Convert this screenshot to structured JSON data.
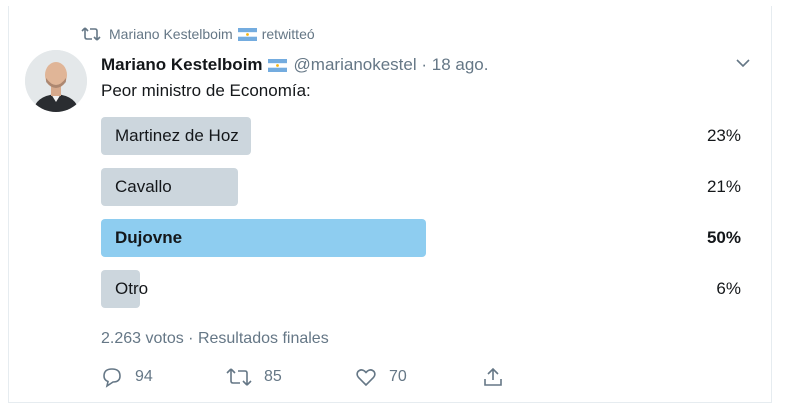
{
  "retweet": {
    "user": "Mariano Kestelboim",
    "action": "retwitteó",
    "icon": "retweet-icon"
  },
  "tweet": {
    "author_name": "Mariano Kestelboim",
    "handle_and_time": "@marianokestel · 18 ago.",
    "text": "Peor ministro de Economía:",
    "avatar_icon": "avatar"
  },
  "poll": {
    "options": [
      {
        "label": "Martinez de Hoz",
        "percent": "23%",
        "fraction": 0.23,
        "winner": false
      },
      {
        "label": "Cavallo",
        "percent": "21%",
        "fraction": 0.21,
        "winner": false
      },
      {
        "label": "Dujovne",
        "percent": "50%",
        "fraction": 0.5,
        "winner": true
      },
      {
        "label": "Otro",
        "percent": "6%",
        "fraction": 0.06,
        "winner": false
      }
    ],
    "summary": "2.263 votos · Resultados finales"
  },
  "actions": {
    "replies": "94",
    "retweets": "85",
    "likes": "70"
  },
  "colors": {
    "bar": "#ccd6dd",
    "winner_bar": "#8ecdf0",
    "secondary_text": "#657786",
    "flag_blue": "#74acdf"
  }
}
